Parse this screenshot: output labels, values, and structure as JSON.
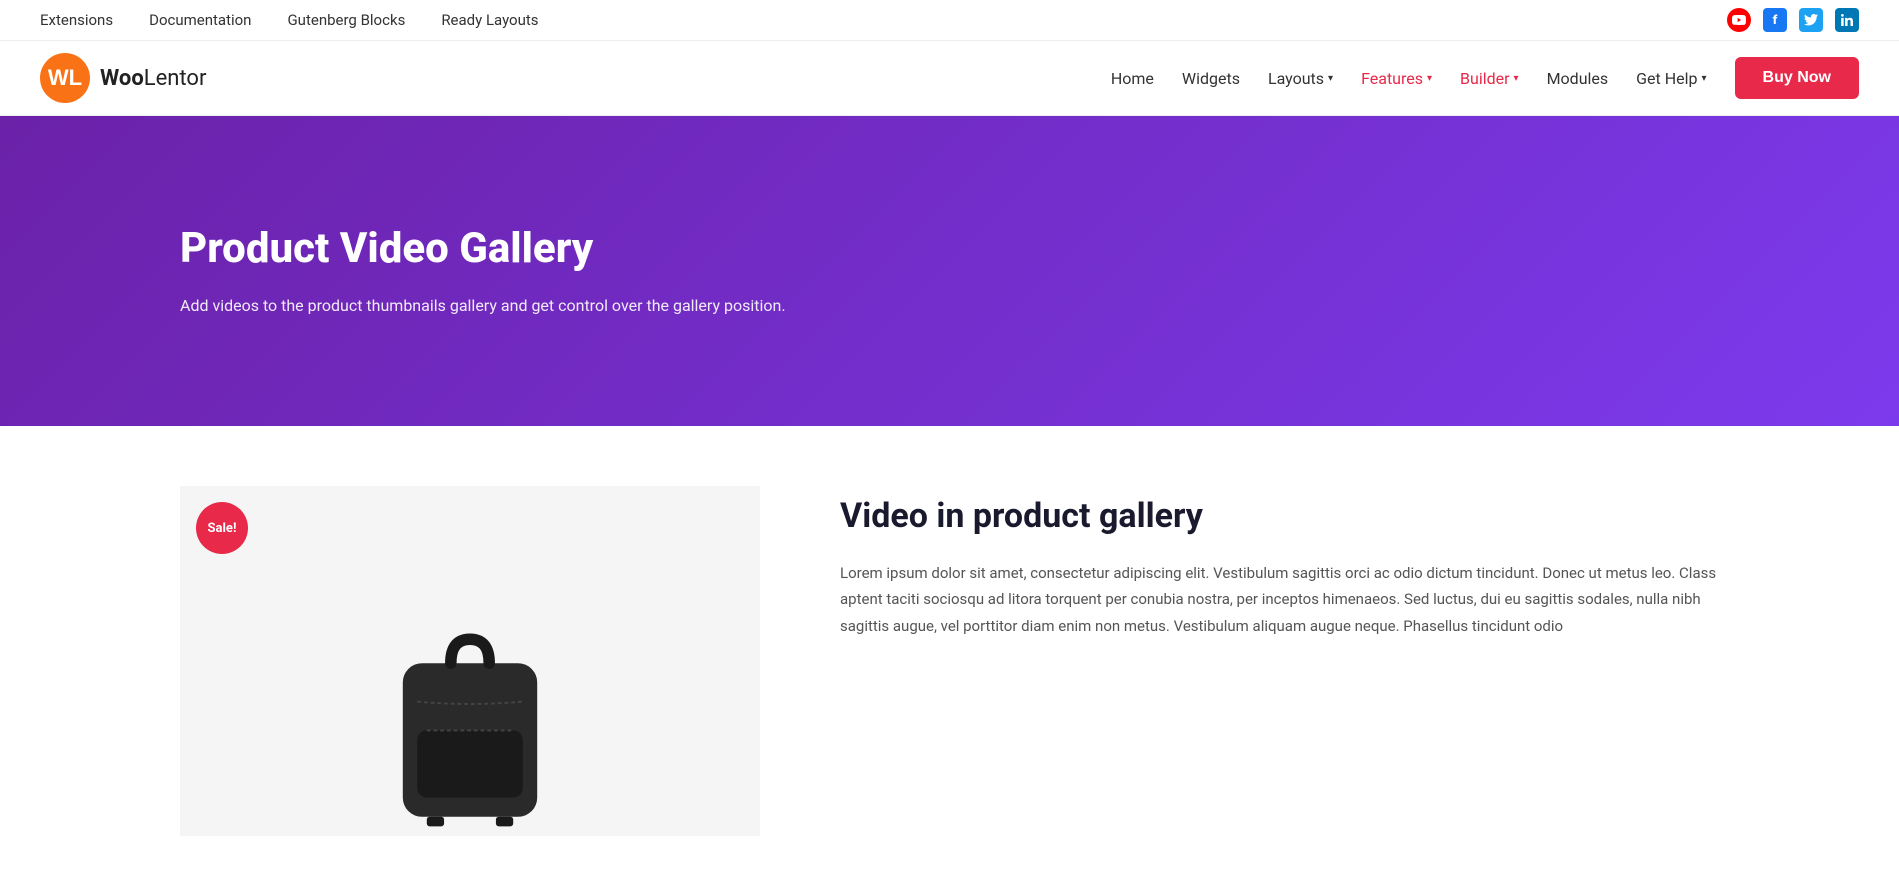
{
  "topbar": {
    "nav_items": [
      {
        "label": "Extensions",
        "href": "#"
      },
      {
        "label": "Documentation",
        "href": "#"
      },
      {
        "label": "Gutenberg Blocks",
        "href": "#"
      },
      {
        "label": "Ready Layouts",
        "href": "#"
      }
    ],
    "social": [
      {
        "name": "youtube",
        "symbol": "▶",
        "css_class": "social-yt"
      },
      {
        "name": "facebook",
        "symbol": "f",
        "css_class": "social-fb"
      },
      {
        "name": "twitter",
        "symbol": "t",
        "css_class": "social-tw"
      },
      {
        "name": "linkedin",
        "symbol": "in",
        "css_class": "social-li"
      }
    ]
  },
  "mainnav": {
    "logo_text_woo": "Woo",
    "logo_text_lentor": "Lentor",
    "links": [
      {
        "label": "Home",
        "active": false,
        "has_dropdown": false
      },
      {
        "label": "Widgets",
        "active": false,
        "has_dropdown": false
      },
      {
        "label": "Layouts",
        "active": false,
        "has_dropdown": true
      },
      {
        "label": "Features",
        "active": true,
        "has_dropdown": true
      },
      {
        "label": "Builder",
        "active": true,
        "has_dropdown": true
      },
      {
        "label": "Modules",
        "active": false,
        "has_dropdown": false
      },
      {
        "label": "Get Help",
        "active": false,
        "has_dropdown": true
      }
    ],
    "cta_label": "Buy Now"
  },
  "hero": {
    "title": "Product Video Gallery",
    "subtitle": "Add videos to the product thumbnails gallery and get control over the gallery position."
  },
  "content": {
    "sale_badge": "Sale!",
    "section_title": "Video in product gallery",
    "body_text": "Lorem ipsum dolor sit amet, consectetur adipiscing elit. Vestibulum sagittis orci ac odio dictum tincidunt. Donec ut metus leo. Class aptent taciti sociosqu ad litora torquent per conubia nostra, per inceptos himenaeos. Sed luctus, dui eu sagittis sodales, nulla nibh sagittis augue, vel porttitor diam enim non metus. Vestibulum aliquam augue neque. Phasellus tincidunt odio"
  }
}
